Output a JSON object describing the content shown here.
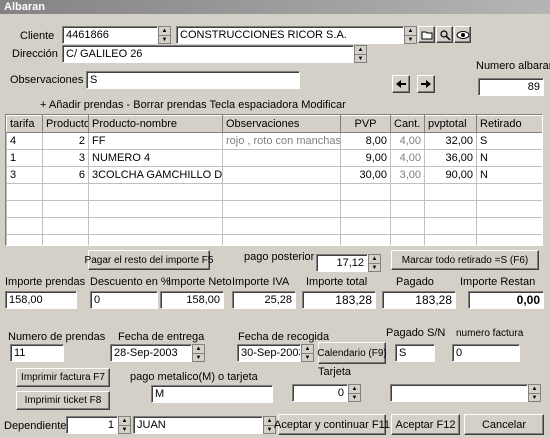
{
  "window": {
    "title": "Albaran"
  },
  "cliente": {
    "label": "Cliente",
    "code": "4461866",
    "name": "CONSTRUCCIONES RICOR S.A."
  },
  "direccion": {
    "label": "Dirección",
    "value": "C/ GALILEO 26"
  },
  "observaciones": {
    "label": "Observaciones",
    "value": "S"
  },
  "numero_albaran": {
    "label": "Numero albaran",
    "value": "89"
  },
  "hint": "+ Añadir prendas - Borrar prendas Tecla espaciadora Modificar",
  "table": {
    "headers": [
      "tarifa",
      "Producto",
      "Producto-nombre",
      "Observaciones",
      "PVP",
      "Cant.",
      "pvptotal",
      "Retirado"
    ],
    "rows": [
      {
        "tarifa": "4",
        "producto": "2",
        "nombre": "FF",
        "obs": "rojo , roto con manchas",
        "pvp": "8,00",
        "cant": "4,00",
        "total": "32,00",
        "retirado": "S"
      },
      {
        "tarifa": "1",
        "producto": "3",
        "nombre": "NUMERO 4",
        "obs": "",
        "pvp": "9,00",
        "cant": "4,00",
        "total": "36,00",
        "retirado": "N"
      },
      {
        "tarifa": "3",
        "producto": "6",
        "nombre": "3COLCHA GAMCHILLO DE M",
        "obs": "",
        "pvp": "30,00",
        "cant": "3,00",
        "total": "90,00",
        "retirado": "N"
      }
    ]
  },
  "buttons": {
    "pagar_resto": "Pagar el resto del importe F5",
    "marcar_retirado": "Marcar todo retirado =S (F6)",
    "calendario": "Calendario (F9)",
    "imprimir_factura": "Imprimir factura F7",
    "imprimir_ticket": "Imprimir ticket F8",
    "aceptar_continuar": "Aceptar y continuar F11",
    "aceptar": "Aceptar F12",
    "cancelar": "Cancelar"
  },
  "pago_posterior": {
    "label": "pago posterior",
    "value": "17,12"
  },
  "importes": {
    "prendas_label": "Importe prendas",
    "prendas": "158,00",
    "descuento_label": "Descuento en %",
    "descuento": "0",
    "neto_label": "Importe Neto",
    "neto": "158,00",
    "iva_label": "Importe IVA",
    "iva": "25,28",
    "total_label": "Importe total",
    "total": "183,28",
    "pagado_label": "Pagado",
    "pagado": "183,28",
    "restan_label": "Importe Restan",
    "restan": "0,00"
  },
  "numero_prendas": {
    "label": "Numero de  prendas",
    "value": "11"
  },
  "fecha_entrega": {
    "label": "Fecha de entrega",
    "value": "28-Sep-2003"
  },
  "fecha_recogida": {
    "label": "Fecha de recogida",
    "value": "30-Sep-2003"
  },
  "pagado_sn": {
    "label": "Pagado S/N",
    "value": "S"
  },
  "numero_factura": {
    "label": "numero factura",
    "value": "0"
  },
  "pago_metalico": {
    "label": "pago metalico(M) o tarjeta",
    "value": "M"
  },
  "tarjeta": {
    "label": "Tarjeta",
    "value": "0",
    "select": ""
  },
  "dependiente": {
    "label": "Dependiente",
    "code": "1",
    "name": "JUAN"
  }
}
